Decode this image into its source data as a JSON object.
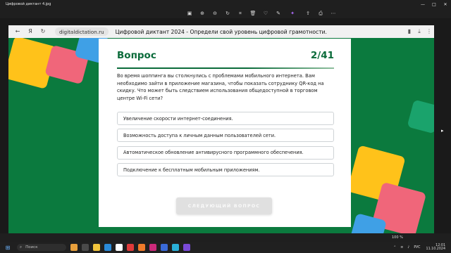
{
  "window": {
    "title": "Цифровой диктант 4.jpg",
    "controls": {
      "minimize": "—",
      "maximize": "□",
      "close": "✕"
    }
  },
  "viewer_toolbar": {
    "icons": [
      "picture-icon",
      "zoom-in-icon",
      "zoom-out-icon",
      "rotate-icon",
      "crop-icon",
      "delete-icon",
      "favorite-icon",
      "edit-icon",
      "magic-icon",
      "share-icon",
      "print-icon",
      "more-icon"
    ]
  },
  "browser": {
    "url_host": "digitaldictation.ru",
    "page_title": "Цифровой диктант 2024 - Определи свой уровень цифровой грамотности.",
    "nav": {
      "back": "←",
      "ya": "Я",
      "reload": "↻"
    },
    "right": {
      "bookmark": "▮",
      "download": "⤓",
      "menu": "⋮"
    }
  },
  "quiz": {
    "heading": "Вопрос",
    "counter": "2/41",
    "question": "Во время шоппинга вы столкнулись с проблемами мобильного интернета. Вам необходимо зайти в приложение магазина, чтобы показать сотруднику QR-код на скидку. Что может быть следствием использования общедоступной в торговом центре Wi-Fi сети?",
    "options": [
      "Увеличение скорости интернет-соединения.",
      "Возможность доступа к личным данным пользователей сети.",
      "Автоматическое обновление антивирусного программного обеспечения.",
      "Подключение к бесплатным мобильным приложениям."
    ],
    "next_button": "СЛЕДУЮЩИЙ ВОПРОС"
  },
  "viewer_status": {
    "zoom": "100 %"
  },
  "taskbar": {
    "search_placeholder": "Поиск",
    "language": "РУС",
    "time": "12:01",
    "date": "11.10.2024"
  },
  "colors": {
    "brand_green": "#0a6b3a",
    "background_green": "#0b7a3e",
    "yellow": "#ffc21a",
    "pink": "#f0667a",
    "blue": "#3fa0e6"
  }
}
